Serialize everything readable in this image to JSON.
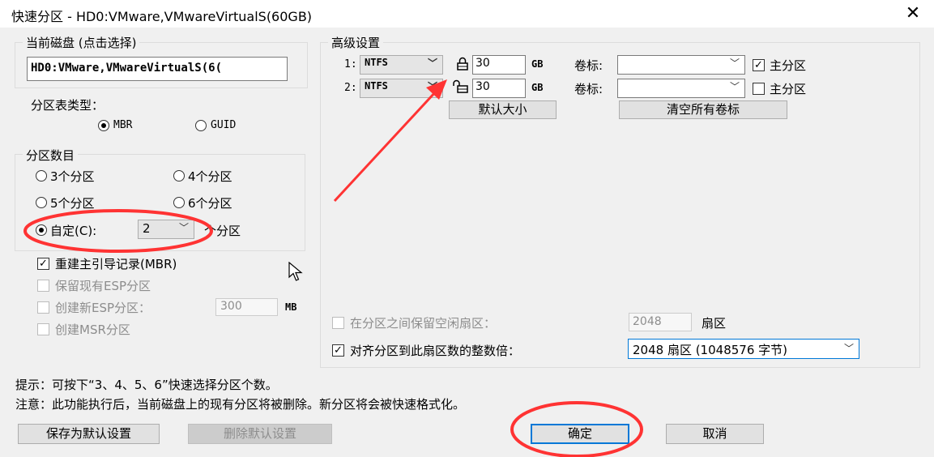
{
  "window": {
    "title": "快速分区 - HD0:VMware,VMwareVirtualS(60GB)",
    "close_glyph": "✕"
  },
  "current_disk": {
    "group_title": "当前磁盘 (点击选择)",
    "value": "HD0:VMware,VMwareVirtualS(6("
  },
  "partition_table": {
    "label": "分区表类型：",
    "options": [
      {
        "label": "MBR",
        "selected": true
      },
      {
        "label": "GUID",
        "selected": false
      }
    ]
  },
  "partition_count": {
    "group_title": "分区数目",
    "options": [
      {
        "label": "3个分区",
        "selected": false
      },
      {
        "label": "4个分区",
        "selected": false
      },
      {
        "label": "5个分区",
        "selected": false
      },
      {
        "label": "6个分区",
        "selected": false
      }
    ],
    "custom": {
      "label": "自定(C):",
      "value": "2",
      "suffix": "个分区",
      "selected": true
    }
  },
  "options": {
    "rebuild_mbr": {
      "label": "重建主引导记录(MBR)",
      "checked": true
    },
    "keep_esp": {
      "label": "保留现有ESP分区",
      "checked": false,
      "enabled": false
    },
    "create_esp": {
      "label": "创建新ESP分区：",
      "checked": false,
      "enabled": false,
      "value": "300",
      "unit": "MB"
    },
    "create_msr": {
      "label": "创建MSR分区",
      "checked": false,
      "enabled": false
    }
  },
  "advanced": {
    "group_title": "高级设置",
    "partitions": [
      {
        "index": "1:",
        "fs": "NTFS",
        "locked": true,
        "size": "30",
        "unit": "GB",
        "volume_label_caption": "卷标:",
        "volume_label": "",
        "primary_label": "主分区",
        "primary": true
      },
      {
        "index": "2:",
        "fs": "NTFS",
        "locked": false,
        "size": "30",
        "unit": "GB",
        "volume_label_caption": "卷标:",
        "volume_label": "",
        "primary_label": "主分区",
        "primary": false
      }
    ],
    "default_size_button": "默认大小",
    "clear_labels_button": "清空所有卷标",
    "reserve_gap": {
      "label": "在分区之间保留空闲扇区：",
      "checked": false,
      "enabled": false,
      "value": "2048",
      "unit": "扇区"
    },
    "align": {
      "label": "对齐分区到此扇区数的整数倍：",
      "checked": true,
      "value": "2048 扇区 (1048576 字节)"
    }
  },
  "hints": {
    "tip": "提示：可按下“3、4、5、6”快速选择分区个数。",
    "note": "注意：此功能执行后，当前磁盘上的现有分区将被删除。新分区将会被快速格式化。"
  },
  "buttons": {
    "save_default": "保存为默认设置",
    "delete_default": "删除默认设置",
    "ok": "确定",
    "cancel": "取消"
  },
  "colors": {
    "annotation": "#ff3333",
    "accent": "#0078d7"
  }
}
